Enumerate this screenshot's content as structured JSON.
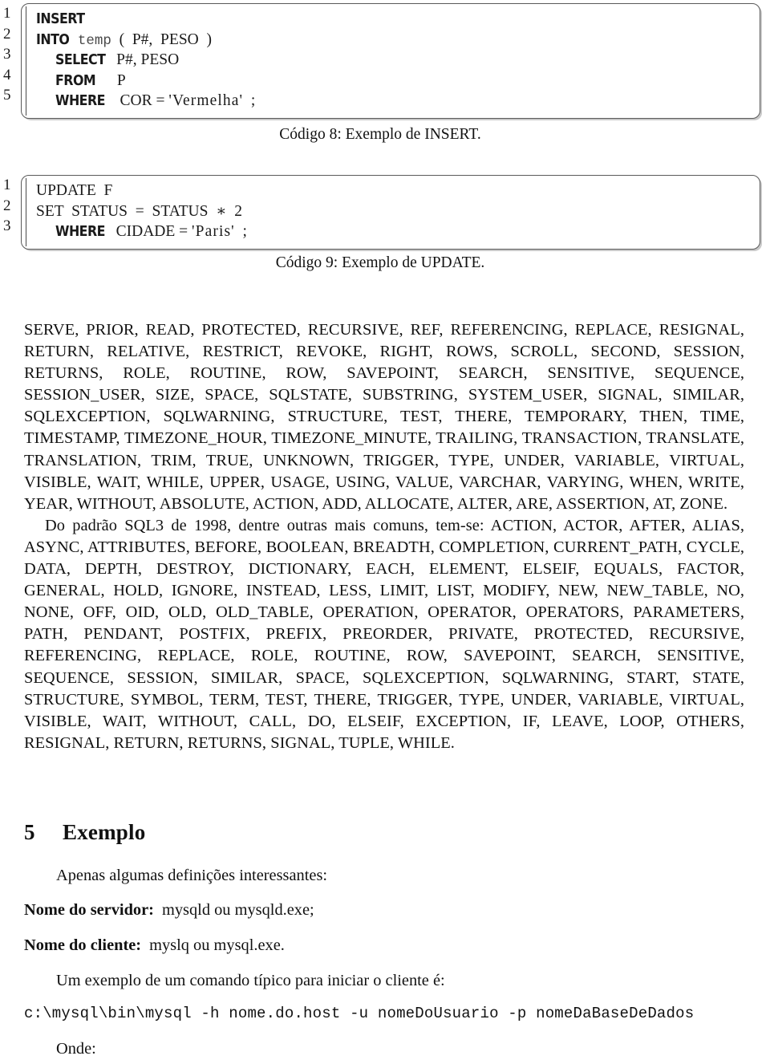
{
  "document": {
    "language": "pt-BR",
    "listings": [
      {
        "id": "codigo-8",
        "caption": "Código 8: Exemplo de INSERT.",
        "line_numbers": [
          "1",
          "2",
          "3",
          "4",
          "5"
        ],
        "lines": [
          [
            {
              "t": "kw",
              "s": "INSERT"
            }
          ],
          [
            {
              "t": "kw",
              "s": "INTO"
            },
            {
              "t": "sp",
              "s": " "
            },
            {
              "t": "mono",
              "s": "temp"
            },
            {
              "t": "id",
              "s": "  (  P#,  PESO  )"
            }
          ],
          [
            {
              "t": "sp",
              "s": "     "
            },
            {
              "t": "kw",
              "s": "SELECT"
            },
            {
              "t": "id",
              "s": " P#, PESO"
            }
          ],
          [
            {
              "t": "sp",
              "s": "     "
            },
            {
              "t": "kw",
              "s": "FROM"
            },
            {
              "t": "id",
              "s": "    P"
            }
          ],
          [
            {
              "t": "sp",
              "s": "     "
            },
            {
              "t": "kw",
              "s": "WHERE"
            },
            {
              "t": "id",
              "s": "  COR = "
            },
            {
              "t": "str",
              "s": "'Vermelha'"
            },
            {
              "t": "id",
              "s": "  ;"
            }
          ]
        ]
      },
      {
        "id": "codigo-9",
        "caption": "Código 9: Exemplo de UPDATE.",
        "line_numbers": [
          "1",
          "2",
          "3"
        ],
        "lines": [
          [
            {
              "t": "id",
              "s": "UPDATE  F"
            }
          ],
          [
            {
              "t": "id",
              "s": "SET  STATUS  =  STATUS  ∗  2"
            }
          ],
          [
            {
              "t": "sp",
              "s": "     "
            },
            {
              "t": "kw",
              "s": "WHERE"
            },
            {
              "t": "id",
              "s": " CIDADE = "
            },
            {
              "t": "str",
              "s": "'Paris'"
            },
            {
              "t": "id",
              "s": "  ;"
            }
          ]
        ]
      }
    ],
    "keyword_paragraph_1": "SERVE, PRIOR, READ, PROTECTED, RECURSIVE, REF, REFERENCING, REPLACE, RESIGNAL, RETURN, RELATIVE, RESTRICT, REVOKE, RIGHT, ROWS, SCROLL, SECOND, SESSION, RETURNS, ROLE, ROUTINE, ROW, SAVEPOINT, SEARCH, SENSITIVE, SEQUENCE, SESSION_USER, SIZE, SPACE, SQLSTATE, SUBSTRING, SYSTEM_USER, SIGNAL, SIMILAR, SQLEXCEPTION, SQLWARNING, STRUCTURE, TEST, THERE, TEMPORARY, THEN, TIME, TIMESTAMP, TIMEZONE_HOUR, TIMEZONE_MINUTE, TRAILING, TRANSACTION, TRANSLATE, TRANSLATION, TRIM, TRUE, UNKNOWN, TRIGGER, TYPE, UNDER, VARIABLE, VIRTUAL, VISIBLE, WAIT, WHILE, UPPER, USAGE, USING, VALUE, VARCHAR, VARYING, WHEN, WRITE, YEAR, WITHOUT, ABSOLUTE, ACTION, ADD, ALLOCATE, ALTER, ARE, ASSERTION, AT, ZONE.",
    "keyword_paragraph_2": "Do padrão SQL3 de 1998, dentre outras mais comuns, tem-se: ACTION, ACTOR, AFTER, ALIAS, ASYNC, ATTRIBUTES, BEFORE, BOOLEAN, BREADTH, COMPLETION, CURRENT_PATH, CYCLE, DATA, DEPTH, DESTROY, DICTIONARY, EACH, ELEMENT, ELSEIF, EQUALS, FACTOR, GENERAL, HOLD, IGNORE, INSTEAD, LESS, LIMIT, LIST, MODIFY, NEW, NEW_TABLE, NO, NONE, OFF, OID, OLD, OLD_TABLE, OPERATION, OPERATOR, OPERATORS, PARAMETERS, PATH, PENDANT, POSTFIX, PREFIX, PREORDER, PRIVATE, PROTECTED, RECURSIVE, REFERENCING, REPLACE, ROLE, ROUTINE, ROW, SAVEPOINT, SEARCH, SENSITIVE, SEQUENCE, SESSION, SIMILAR, SPACE, SQLEXCEPTION, SQLWARNING, START, STATE, STRUCTURE, SYMBOL, TERM, TEST, THERE, TRIGGER, TYPE, UNDER, VARIABLE, VIRTUAL, VISIBLE, WAIT, WITHOUT, CALL, DO, ELSEIF, EXCEPTION, IF, LEAVE, LOOP, OTHERS, RESIGNAL, RETURN, RETURNS, SIGNAL, TUPLE, WHILE.",
    "section": {
      "number": "5",
      "title": "Exemplo"
    },
    "intro_line": "Apenas algumas definições interessantes:",
    "definitions": [
      {
        "term": "Nome do servidor:",
        "value": "mysqld ou mysqld.exe;"
      },
      {
        "term": "Nome do cliente:",
        "value": "myslq ou mysql.exe."
      }
    ],
    "example_lead": "Um exemplo de um comando típico para iniciar o cliente é:",
    "command": "c:\\mysql\\bin\\mysql -h nome.do.host -u nomeDoUsuario -p nomeDaBaseDeDados",
    "trailing_line": "Onde:"
  }
}
